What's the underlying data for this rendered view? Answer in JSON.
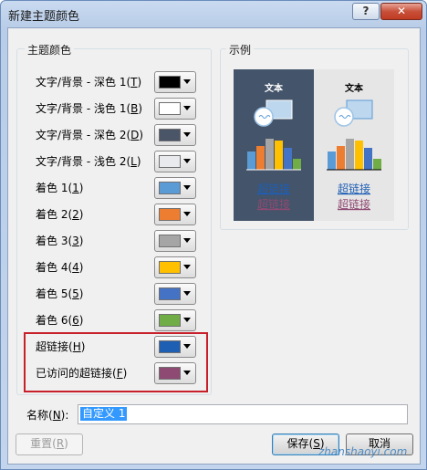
{
  "window": {
    "title": "新建主题颜色"
  },
  "title_buttons": {
    "help": "?",
    "close": "✕"
  },
  "theme_colors": {
    "group_label": "主题颜色",
    "rows": [
      {
        "label": "文字/背景 - 深色 1(",
        "key": "T",
        "end": ")",
        "color": "#000000"
      },
      {
        "label": "文字/背景 - 浅色 1(",
        "key": "B",
        "end": ")",
        "color": "#ffffff"
      },
      {
        "label": "文字/背景 - 深色 2(",
        "key": "D",
        "end": ")",
        "color": "#4a5568"
      },
      {
        "label": "文字/背景 - 浅色 2(",
        "key": "L",
        "end": ")",
        "color": "#e8eaed"
      },
      {
        "label": "着色 1(",
        "key": "1",
        "end": ")",
        "color": "#5b9bd5"
      },
      {
        "label": "着色 2(",
        "key": "2",
        "end": ")",
        "color": "#ed7d31"
      },
      {
        "label": "着色 3(",
        "key": "3",
        "end": ")",
        "color": "#a5a5a5"
      },
      {
        "label": "着色 4(",
        "key": "4",
        "end": ")",
        "color": "#ffc000"
      },
      {
        "label": "着色 5(",
        "key": "5",
        "end": ")",
        "color": "#4472c4"
      },
      {
        "label": "着色 6(",
        "key": "6",
        "end": ")",
        "color": "#70ad47"
      },
      {
        "label": "超链接(",
        "key": "H",
        "end": ")",
        "color": "#1e5fb4"
      },
      {
        "label": "已访问的超链接(",
        "key": "F",
        "end": ")",
        "color": "#8e4a72"
      }
    ]
  },
  "sample": {
    "group_label": "示例",
    "text_label": "文本",
    "hyperlink": "超链接",
    "visited_hyperlink": "超链接",
    "dark_bg": "#44546a",
    "light_bg": "#e7e6e6",
    "bar_colors": [
      "#5b9bd5",
      "#ed7d31",
      "#a5a5a5",
      "#ffc000",
      "#4472c4",
      "#70ad47"
    ]
  },
  "name_field": {
    "label": "名称(",
    "key": "N",
    "end": "):",
    "value": "自定义 1"
  },
  "buttons": {
    "reset": {
      "label": "重置(",
      "key": "R",
      "end": ")"
    },
    "save": {
      "label": "保存(",
      "key": "S",
      "end": ")"
    },
    "cancel": "取消"
  },
  "watermark": "zhanshaoyi.com"
}
